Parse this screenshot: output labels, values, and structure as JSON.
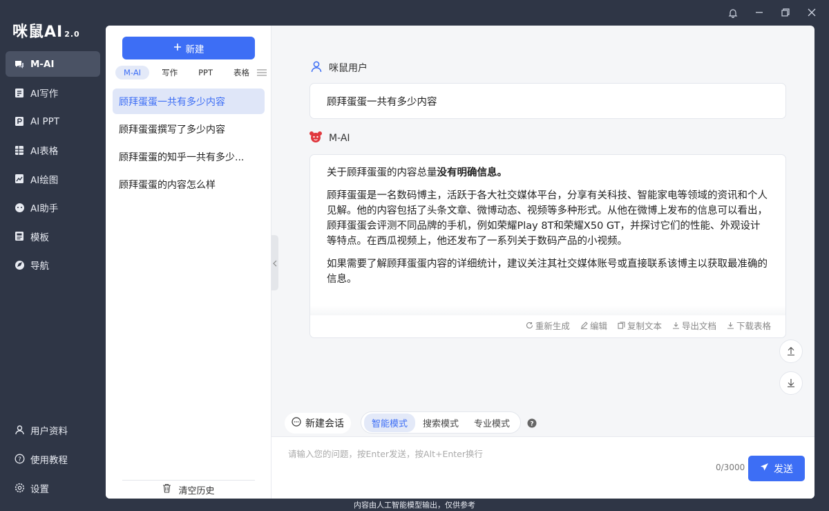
{
  "app": {
    "logo": "咪鼠AI",
    "version": "2.0"
  },
  "nav": {
    "items": [
      {
        "label": "M-AI",
        "icon": "chat-icon"
      },
      {
        "label": "AI写作",
        "icon": "write-icon"
      },
      {
        "label": "AI PPT",
        "icon": "ppt-icon"
      },
      {
        "label": "AI表格",
        "icon": "table-icon"
      },
      {
        "label": "AI绘图",
        "icon": "paint-icon"
      },
      {
        "label": "AI助手",
        "icon": "assistant-icon"
      },
      {
        "label": "模板",
        "icon": "template-icon"
      },
      {
        "label": "导航",
        "icon": "navigation-icon"
      }
    ],
    "bottom": [
      {
        "label": "用户资料",
        "icon": "user-icon"
      },
      {
        "label": "使用教程",
        "icon": "help-icon"
      },
      {
        "label": "设置",
        "icon": "gear-icon"
      }
    ]
  },
  "history": {
    "new_button": "新建",
    "tabs": [
      "M-AI",
      "写作",
      "PPT",
      "表格"
    ],
    "items": [
      "顾拜蛋蛋一共有多少内容",
      "顾拜蛋蛋撰写了多少内容",
      "顾拜蛋蛋的知乎一共有多少...",
      "顾拜蛋蛋的内容怎么样"
    ],
    "clear": "清空历史"
  },
  "chat": {
    "user_name": "咪鼠用户",
    "user_message": "顾拜蛋蛋一共有多少内容",
    "ai_name": "M-AI",
    "ai_p1_prefix": "关于顾拜蛋蛋的内容总量",
    "ai_p1_bold": "没有明确信息。",
    "ai_p2": "顾拜蛋蛋是一名数码博主，活跃于各大社交媒体平台，分享有关科技、智能家电等领域的资讯和个人见解。他的内容包括了头条文章、微博动态、视频等多种形式。从他在微博上发布的信息可以看出，顾拜蛋蛋会评测不同品牌的手机，例如荣耀Play 8T和荣耀X50 GT，并探讨它们的性能、外观设计等特点。在西瓜视频上，他还发布了一系列关于数码产品的小视频。",
    "ai_p3": "如果需要了解顾拜蛋蛋内容的详细统计，建议关注其社交媒体账号或直接联系该博主以获取最准确的信息。",
    "actions": [
      "重新生成",
      "编辑",
      "复制文本",
      "导出文档",
      "下载表格"
    ]
  },
  "composer": {
    "new_chat": "新建会话",
    "modes": [
      "智能模式",
      "搜索模式",
      "专业模式"
    ],
    "placeholder": "请输入您的问题，按Enter发送，按Alt+Enter换行",
    "counter": "0/3000",
    "send": "发送"
  },
  "footer": "内容由人工智能模型输出，仅供参考",
  "colors": {
    "accent": "#3d6ef5",
    "sidebar": "#2f3646"
  }
}
